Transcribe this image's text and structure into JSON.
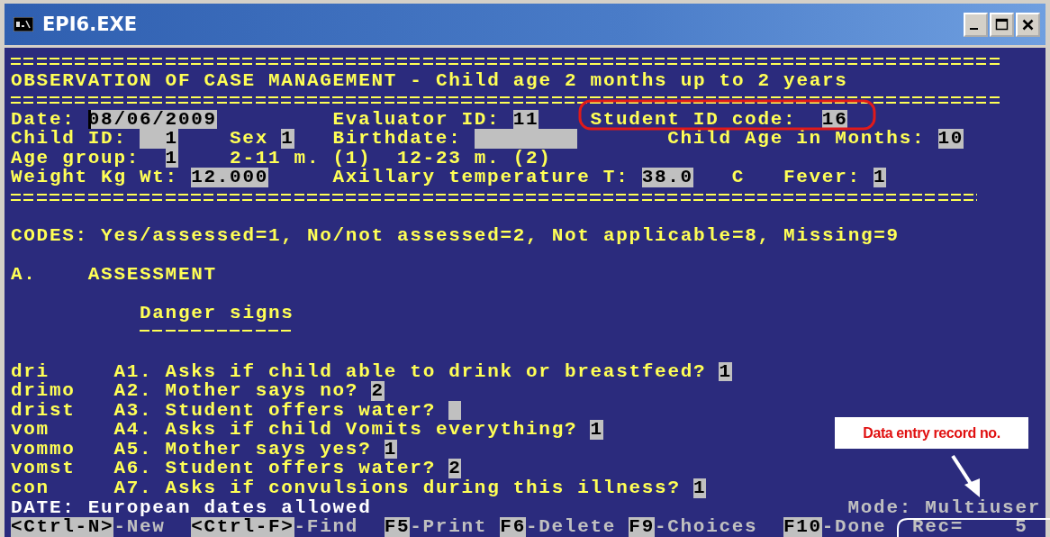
{
  "window": {
    "title": "EPI6.EXE"
  },
  "form_title": "OBSERVATION OF CASE MANAGEMENT - Child age 2 months up to 2 years",
  "header_rows": [
    [
      {
        "kind": "field",
        "label": "Date:",
        "value": "08/06/2009",
        "focused": true
      },
      {
        "kind": "field",
        "label": "Evaluator ID:",
        "value": "11",
        "focused": false
      },
      {
        "kind": "field",
        "label": "Student ID code:",
        "value": "16",
        "focused": false
      }
    ],
    [
      {
        "kind": "field",
        "label": "Child ID:",
        "value": "1",
        "focused": false
      },
      {
        "kind": "field",
        "label": "Sex",
        "value": "1",
        "focused": false
      },
      {
        "kind": "field",
        "label": "Birthdate:",
        "focused": false
      },
      {
        "kind": "field",
        "label": "Child Age in Months:",
        "value": "10",
        "focused": false
      }
    ],
    [
      {
        "kind": "field",
        "label": "Age group:",
        "value": "1",
        "focused": false
      },
      {
        "kind": "note",
        "text": "2-11 m. (1)  12-23 m. (2)"
      }
    ],
    [
      {
        "kind": "field",
        "label": "Weight Kg Wt:",
        "value": "12.000",
        "focused": false
      },
      {
        "kind": "field",
        "label": "Axillary temperature T:",
        "value": "38.0",
        "focused": false
      },
      {
        "kind": "note",
        "text": "C"
      },
      {
        "kind": "field",
        "label": "Fever:",
        "value": "1",
        "focused": false
      }
    ]
  ],
  "codes": "CODES: Yes/assessed=1, No/not assessed=2, Not applicable=8, Missing=9",
  "section": {
    "letter": "A.",
    "title": "ASSESSMENT"
  },
  "subsection": "Danger signs",
  "questions": [
    {
      "variable": "dri",
      "text": "A1. Asks if child able to drink or breastfeed?",
      "answer": "1"
    },
    {
      "variable": "drimo",
      "text": "A2. Mother says no?",
      "answer": "2"
    },
    {
      "variable": "drist",
      "text": "A3. Student offers water?"
    },
    {
      "variable": "vom",
      "text": "A4. Asks if child Vomits everything?",
      "answer": "1"
    },
    {
      "variable": "vommo",
      "text": "A5. Mother says yes?",
      "answer": "1"
    },
    {
      "variable": "vomst",
      "text": "A6. Student offers water?",
      "answer": "2"
    },
    {
      "variable": "con",
      "text": "A7. Asks if convulsions during this illness?",
      "answer": "1"
    }
  ],
  "status": {
    "message": "DATE: European dates allowed",
    "mode": "Mode: Multiuser"
  },
  "keys": [
    {
      "key": "<Ctrl-N>",
      "action": "-New"
    },
    {
      "key": "<Ctrl-F>",
      "action": "-Find"
    },
    {
      "key": "F5",
      "action": "-Print"
    },
    {
      "key": "F6",
      "action": "-Delete"
    },
    {
      "key": "F9",
      "action": "-Choices"
    },
    {
      "key": "F10",
      "action": "-Done"
    }
  ],
  "record": {
    "label": "Rec=",
    "value": "5"
  },
  "callout": "Data entry record no."
}
